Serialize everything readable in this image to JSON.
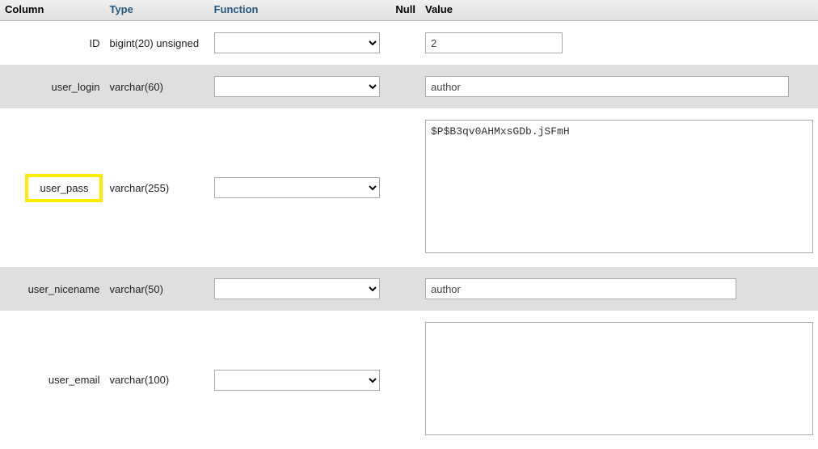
{
  "headers": {
    "column": "Column",
    "type": "Type",
    "function": "Function",
    "null": "Null",
    "value": "Value"
  },
  "rows": [
    {
      "column": "ID",
      "type": "bigint(20) unsigned",
      "function": "",
      "value": "2",
      "kind": "short",
      "highlight": false
    },
    {
      "column": "user_login",
      "type": "varchar(60)",
      "function": "",
      "value": "author",
      "kind": "medium",
      "highlight": false
    },
    {
      "column": "user_pass",
      "type": "varchar(255)",
      "function": "",
      "value": "$P$B3qv0AHMxsGDb.jSFmH",
      "kind": "textarea",
      "highlight": true
    },
    {
      "column": "user_nicename",
      "type": "varchar(50)",
      "function": "",
      "value": "author",
      "kind": "medium2",
      "highlight": false
    },
    {
      "column": "user_email",
      "type": "varchar(100)",
      "function": "",
      "value": "",
      "kind": "textarea2",
      "highlight": false
    }
  ]
}
